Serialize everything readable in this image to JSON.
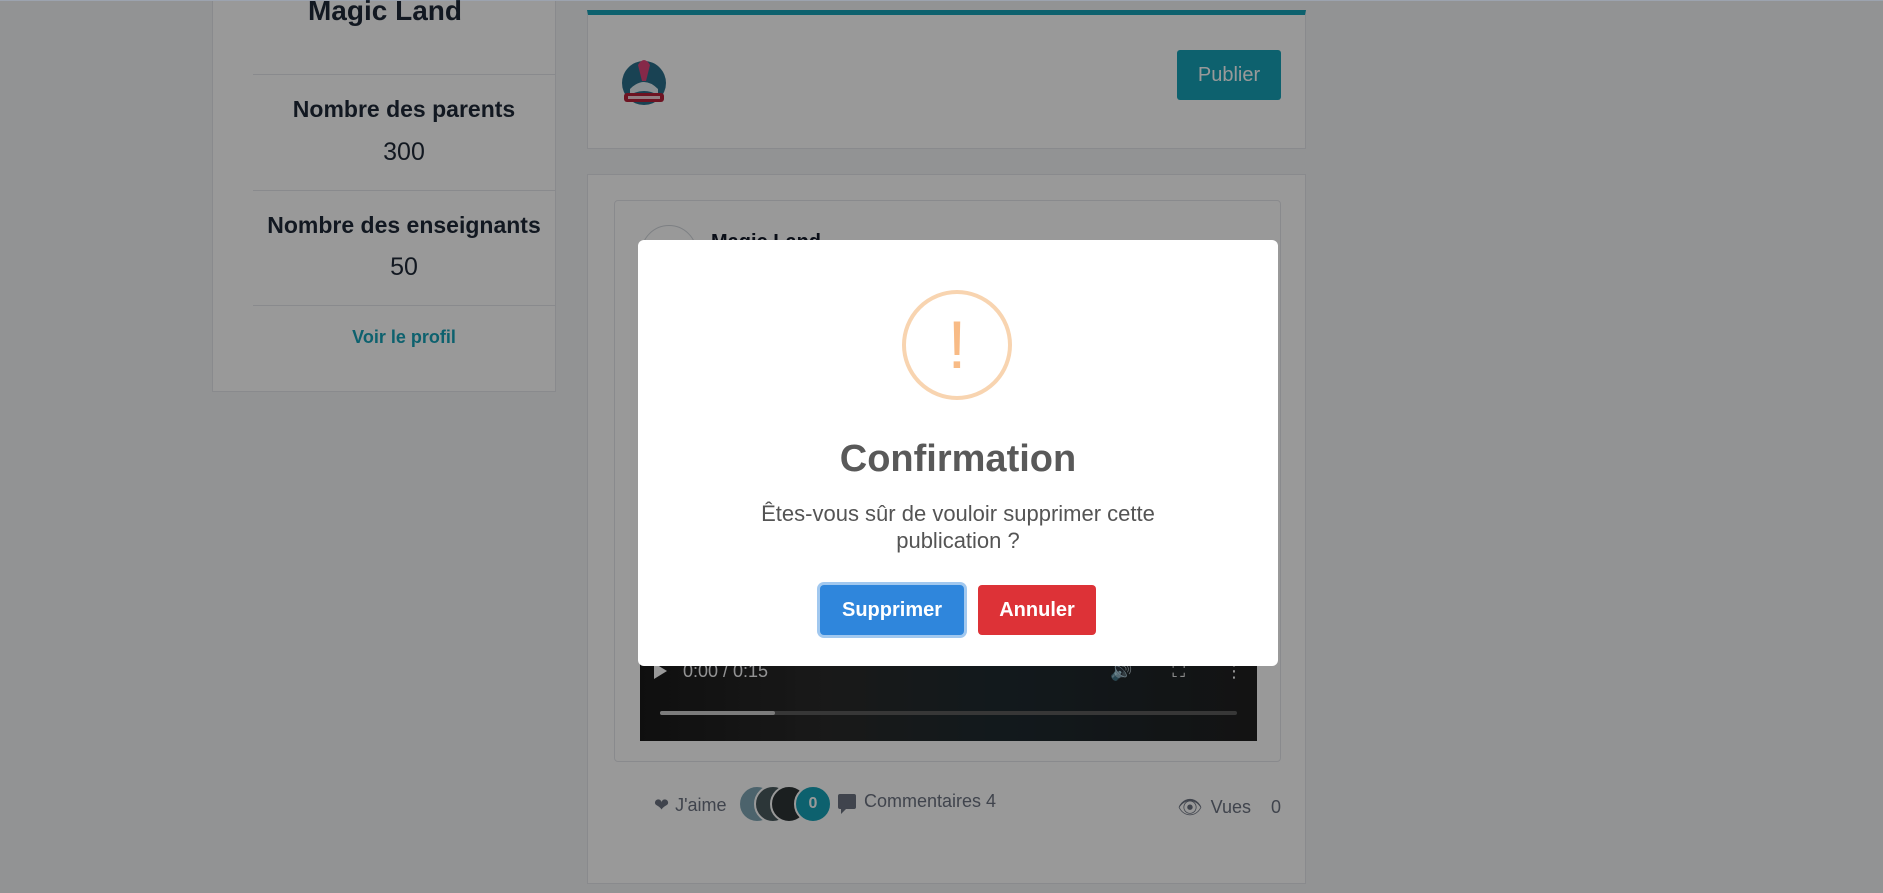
{
  "sidebar": {
    "title": "Magic Land",
    "stats": [
      {
        "label": "Nombre des parents",
        "value": "300"
      },
      {
        "label": "Nombre des enseignants",
        "value": "50"
      }
    ],
    "profile_link": "Voir le profil"
  },
  "composer": {
    "logo_icon": "magic-land-logo",
    "publish_label": "Publier",
    "accent_color": "#17a2b8"
  },
  "post": {
    "author_name": "Magic Land",
    "video": {
      "time": "0:00 / 0:15",
      "progress_fraction": 0.2
    },
    "footer": {
      "like_label": "J'aime",
      "like_count": "0",
      "comments_label": "Commentaires 4",
      "views_label": "Vues",
      "views_count": "0"
    }
  },
  "modal": {
    "icon": "warning-icon",
    "icon_glyph": "!",
    "title": "Confirmation",
    "text": "Êtes-vous sûr de vouloir supprimer cette publication ?",
    "confirm_label": "Supprimer",
    "cancel_label": "Annuler",
    "confirm_color": "#2f86dc",
    "cancel_color": "#dd3237"
  }
}
